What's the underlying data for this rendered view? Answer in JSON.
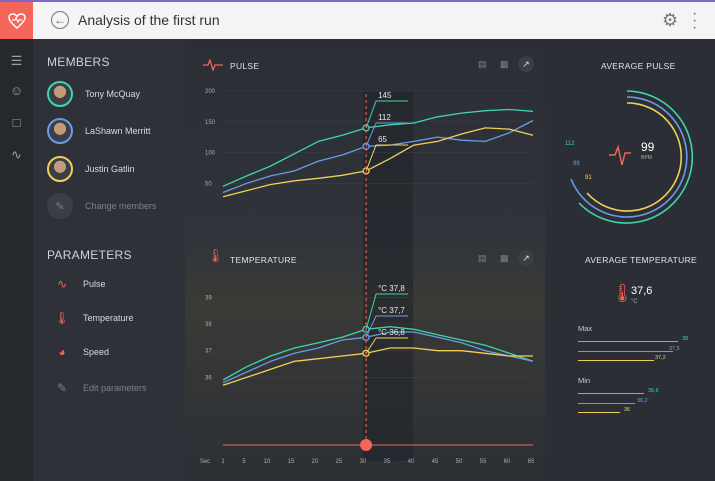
{
  "header": {
    "title": "Analysis of the first run"
  },
  "sidebar": {
    "members_title": "MEMBERS",
    "members": [
      {
        "name": "Tony McQuay",
        "ring": "#3ed6a8"
      },
      {
        "name": "LaShawn Merritt",
        "ring": "#6a9be8"
      },
      {
        "name": "Justin Gatlin",
        "ring": "#f2cf58"
      }
    ],
    "change_members": "Change members",
    "parameters_title": "PARAMETERS",
    "parameters": [
      {
        "label": "Pulse",
        "icon": "pulse-icon"
      },
      {
        "label": "Temperature",
        "icon": "thermometer-icon"
      },
      {
        "label": "Speed",
        "icon": "speedometer-icon"
      }
    ],
    "edit_parameters": "Edit parameters"
  },
  "pulse_panel": {
    "title": "PULSE",
    "y_ticks": [
      "200",
      "150",
      "100",
      "50"
    ],
    "markers": [
      "145",
      "112",
      "65"
    ]
  },
  "temp_panel": {
    "title": "TEMPERATURE",
    "y_ticks": [
      "39",
      "38",
      "37",
      "36"
    ],
    "markers": [
      "37,8",
      "37,7",
      "36,8"
    ],
    "unit": "°C"
  },
  "timeline": {
    "ticks": [
      "Sec",
      "1",
      "5",
      "10",
      "15",
      "20",
      "25",
      "30",
      "35",
      "40",
      "45",
      "50",
      "55",
      "60",
      "65"
    ],
    "value": 30
  },
  "avg_pulse": {
    "title": "AVERAGE PULSE",
    "value": "99",
    "unit": "BPM",
    "labels": [
      "112",
      "98",
      "91"
    ]
  },
  "avg_temp": {
    "title": "AVERAGE TEMPERATURE",
    "value": "37,6",
    "unit": "°C",
    "max_label": "Max",
    "max_values": [
      "38",
      "37,5",
      "37,2"
    ],
    "min_label": "Min",
    "min_values": [
      "36,6",
      "36,2",
      "36"
    ]
  },
  "colors": {
    "accent": "#f4655a",
    "series": [
      "#3ed6a8",
      "#6a9be8",
      "#f2cf58"
    ]
  },
  "chart_data": [
    {
      "type": "line",
      "title": "PULSE",
      "x": [
        0,
        5,
        10,
        15,
        20,
        25,
        30,
        35,
        40,
        45,
        50,
        55,
        60,
        65
      ],
      "ylim": [
        0,
        200
      ],
      "series": [
        {
          "values": [
            45,
            62,
            78,
            98,
            118,
            128,
            140,
            145,
            148,
            158,
            164,
            168,
            170,
            167
          ]
        },
        {
          "values": [
            35,
            50,
            62,
            70,
            86,
            96,
            110,
            112,
            118,
            125,
            120,
            118,
            132,
            152
          ]
        },
        {
          "values": [
            28,
            38,
            48,
            54,
            58,
            63,
            70,
            90,
            112,
            118,
            130,
            140,
            138,
            128
          ]
        }
      ]
    },
    {
      "type": "line",
      "title": "TEMPERATURE",
      "x": [
        0,
        5,
        10,
        15,
        20,
        25,
        30,
        35,
        40,
        45,
        50,
        55,
        60,
        65
      ],
      "ylim": [
        35,
        39.5
      ],
      "series": [
        {
          "values": [
            35.9,
            36.4,
            36.8,
            37.1,
            37.3,
            37.5,
            37.8,
            37.9,
            37.8,
            37.6,
            37.4,
            37.2,
            36.9,
            36.6
          ]
        },
        {
          "values": [
            35.8,
            36.2,
            36.6,
            36.9,
            37.1,
            37.4,
            37.5,
            37.7,
            37.7,
            37.5,
            37.3,
            37.0,
            36.8,
            36.6
          ]
        },
        {
          "values": [
            35.7,
            36.0,
            36.3,
            36.6,
            36.7,
            36.8,
            36.9,
            37.1,
            37.1,
            37.0,
            37.0,
            36.9,
            36.8,
            36.8
          ]
        }
      ]
    }
  ]
}
